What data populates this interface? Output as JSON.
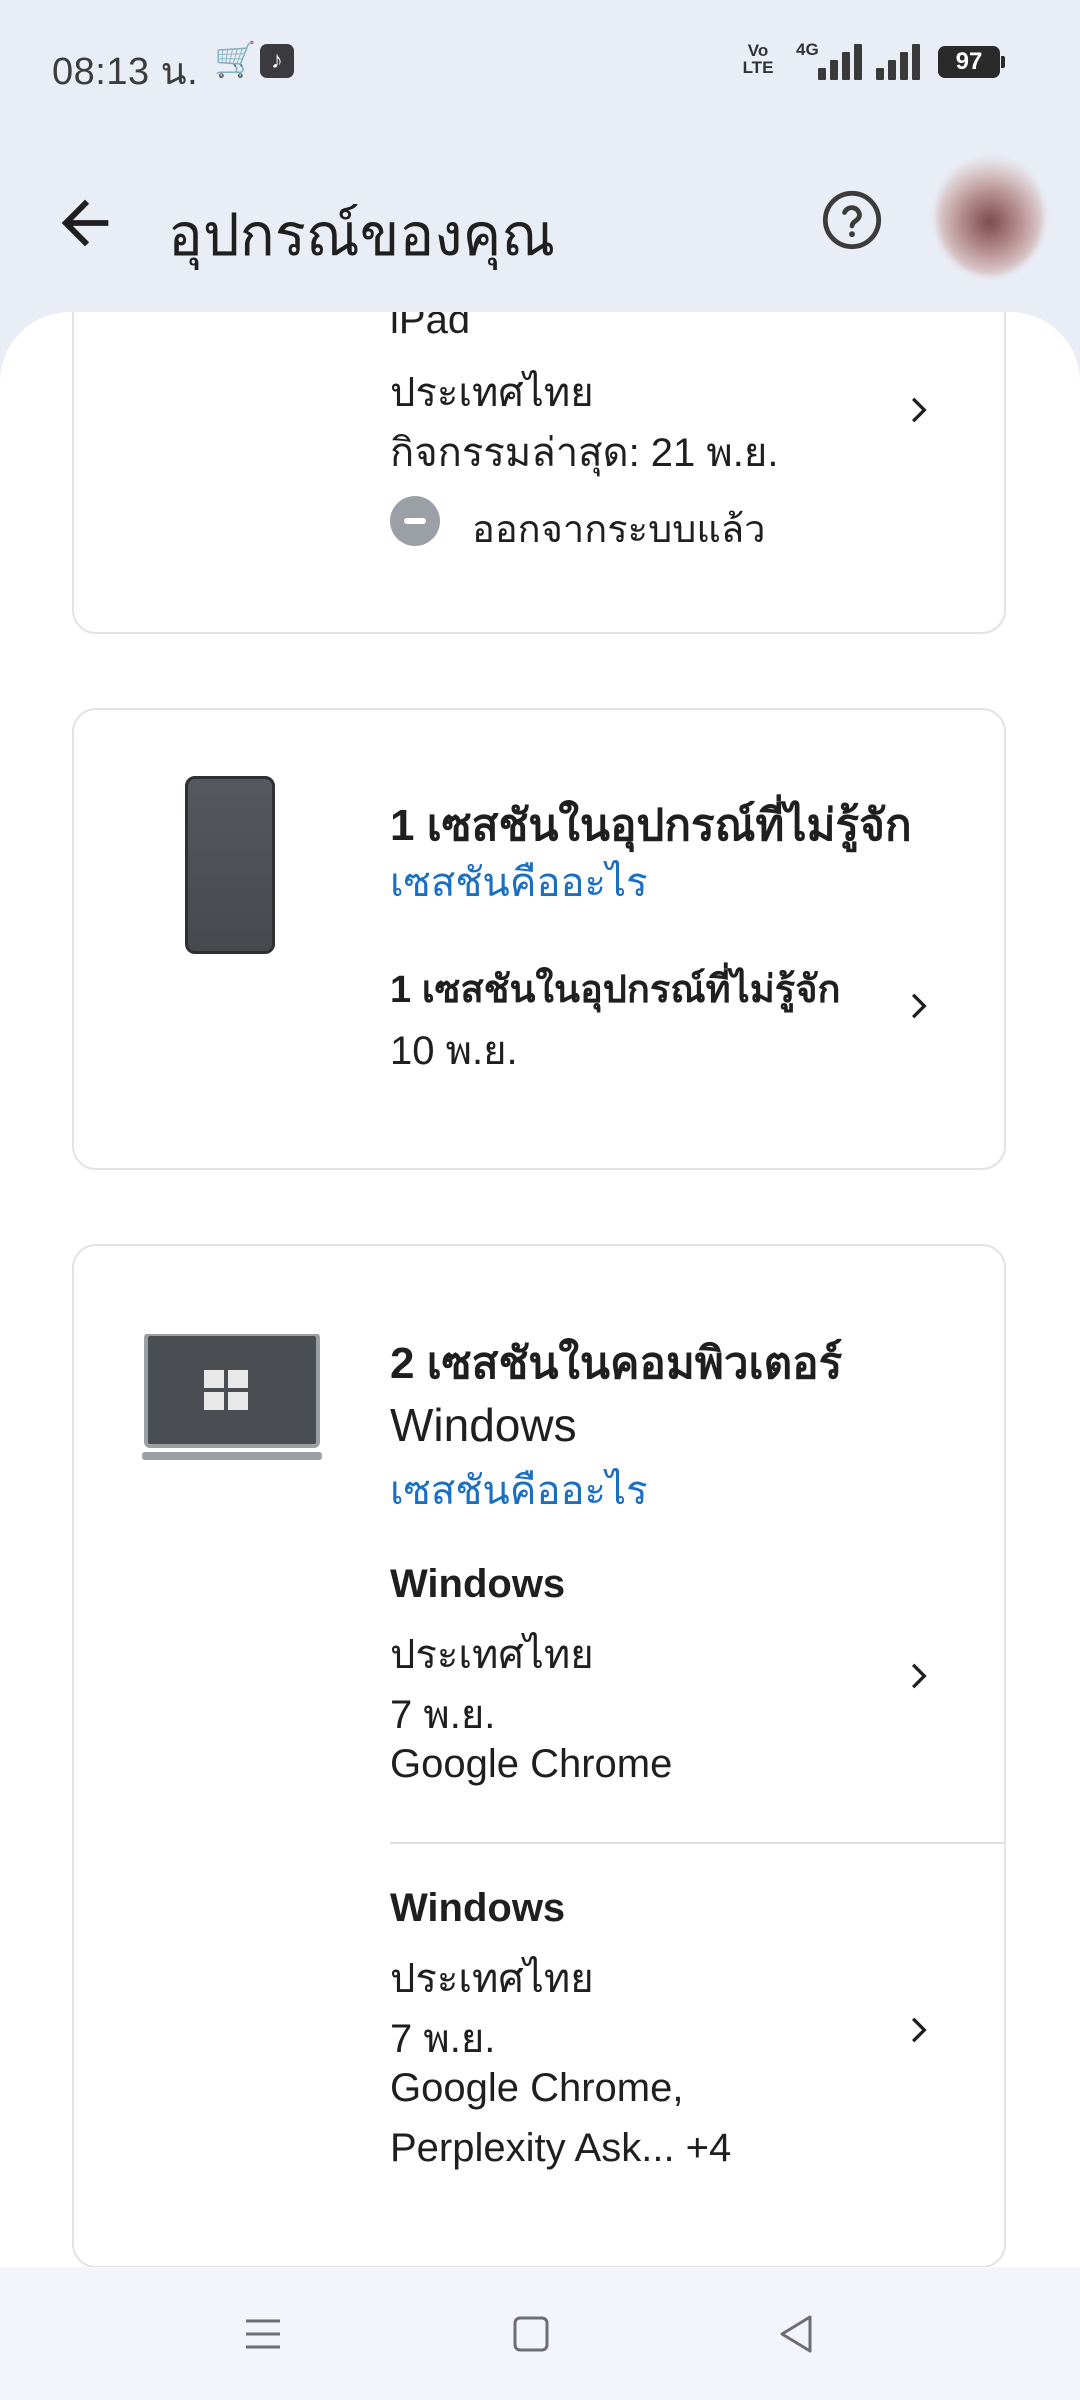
{
  "status_bar": {
    "time": "08:13 น.",
    "volte_line1": "Vo",
    "volte_line2": "LTE",
    "network": "4G",
    "battery": "97"
  },
  "app_bar": {
    "title": "อุปกรณ์ของคุณ"
  },
  "cards": [
    {
      "device_name": "iPad",
      "location": "ประเทศไทย",
      "last_activity": "กิจกรรมล่าสุด: 21 พ.ย.",
      "status": "ออกจากระบบแล้ว"
    },
    {
      "heading": "1 เซสชันในอุปกรณ์ที่ไม่รู้จัก",
      "link": "เซสชันคืออะไร",
      "session_title": "1 เซสชันในอุปกรณ์ที่ไม่รู้จัก",
      "session_date": "10 พ.ย."
    },
    {
      "heading_line1": "2 เซสชันในคอมพิวเตอร์",
      "heading_line2": "Windows",
      "link": "เซสชันคืออะไร",
      "sessions": [
        {
          "name": "Windows",
          "location": "ประเทศไทย",
          "date": "7 พ.ย.",
          "apps_line1": "Google Chrome",
          "apps_line2": ""
        },
        {
          "name": "Windows",
          "location": "ประเทศไทย",
          "date": "7 พ.ย.",
          "apps_line1": "Google Chrome,",
          "apps_line2": "Perplexity Ask... +4"
        }
      ]
    }
  ],
  "icons": {
    "back": "arrow-back-icon",
    "help": "help-circle-icon",
    "chevron": "chevron-right-icon",
    "phone": "smartphone-icon",
    "laptop": "windows-laptop-icon"
  },
  "colors": {
    "link": "#1a6fc2",
    "app_bar_bg": "#e9edf6",
    "status_signed_out": "#9aa0a6"
  }
}
